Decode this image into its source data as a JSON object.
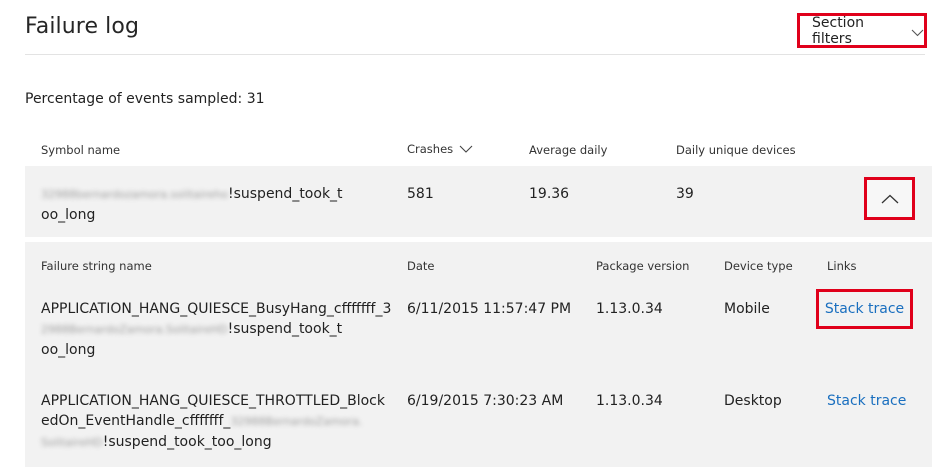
{
  "header": {
    "title": "Failure log",
    "section_filters_label": "Section filters"
  },
  "sample_text": "Percentage of events sampled: 31",
  "main_table": {
    "columns": {
      "symbol": "Symbol name",
      "crashes": "Crashes",
      "average": "Average daily",
      "devices": "Daily unique devices"
    },
    "row": {
      "symbol_prefix": "32988bernardozamora.solitaireho",
      "symbol_line1": "!suspend_took_t",
      "symbol_line2": "oo_long",
      "crashes": "581",
      "average": "19.36",
      "devices": "39"
    }
  },
  "detail_table": {
    "columns": {
      "failure": "Failure string name",
      "date": "Date",
      "package": "Package version",
      "device": "Device type",
      "links": "Links"
    },
    "rows": [
      {
        "line1": "APPLICATION_HANG_QUIESCE_BusyHang_cfffffff_3",
        "line2_blur": "2988BernardoZamora.SolitaireHD",
        "line2": "!suspend_took_t",
        "line3": "oo_long",
        "date": "6/11/2015 11:57:47 PM",
        "package": "1.13.0.34",
        "device": "Mobile",
        "link": "Stack trace"
      },
      {
        "line1": "APPLICATION_HANG_QUIESCE_THROTTLED_Block",
        "line2": "edOn_EventHandle_cfffffff_",
        "line2_blur": "32988BernardoZamora.",
        "line3_blur": "SolitaireHD",
        "line3": "!suspend_took_too_long",
        "date": "6/19/2015 7:30:23 AM",
        "package": "1.13.0.34",
        "device": "Desktop",
        "link": "Stack trace"
      }
    ]
  },
  "icons": {
    "section_filters": "chevron-down-icon",
    "crashes_sort": "chevron-down-icon",
    "collapse": "chevron-up-icon"
  },
  "colors": {
    "highlight": "#e0001b",
    "link": "#1a6fbf",
    "row_bg": "#f2f2f2"
  }
}
